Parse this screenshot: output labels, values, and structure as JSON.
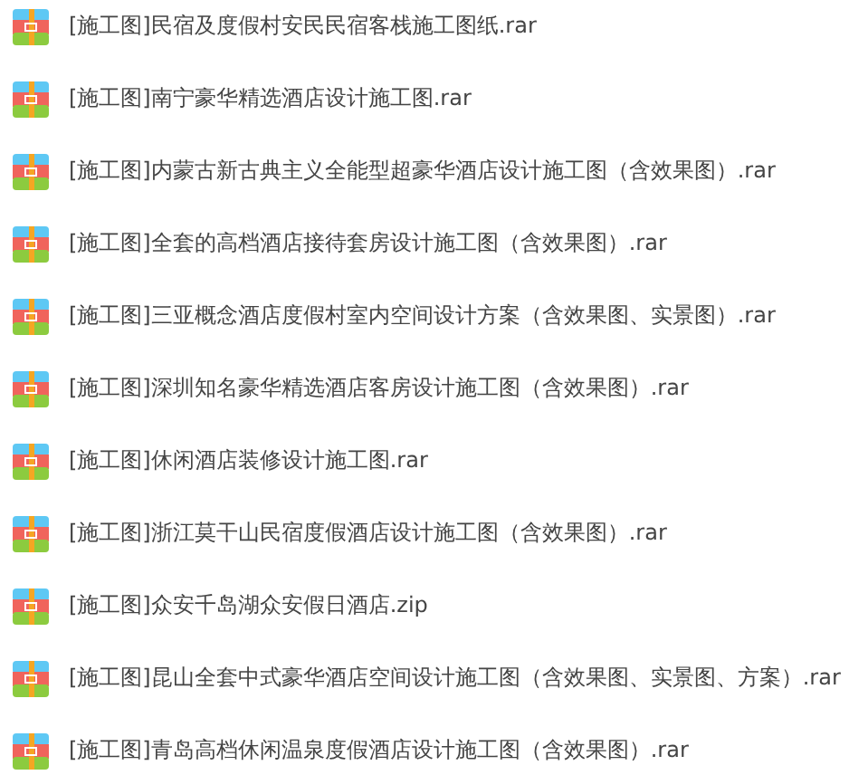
{
  "files": [
    {
      "name": "[施工图]民宿及度假村安民民宿客栈施工图纸.rar"
    },
    {
      "name": "[施工图]南宁豪华精选酒店设计施工图.rar"
    },
    {
      "name": "[施工图]内蒙古新古典主义全能型超豪华酒店设计施工图（含效果图）.rar"
    },
    {
      "name": "[施工图]全套的高档酒店接待套房设计施工图（含效果图）.rar"
    },
    {
      "name": "[施工图]三亚概念酒店度假村室内空间设计方案（含效果图、实景图）.rar"
    },
    {
      "name": "[施工图]深圳知名豪华精选酒店客房设计施工图（含效果图）.rar"
    },
    {
      "name": "[施工图]休闲酒店装修设计施工图.rar"
    },
    {
      "name": "[施工图]浙江莫干山民宿度假酒店设计施工图（含效果图）.rar"
    },
    {
      "name": "[施工图]众安千岛湖众安假日酒店.zip"
    },
    {
      "name": "[施工图]昆山全套中式豪华酒店空间设计施工图（含效果图、实景图、方案）.rar"
    },
    {
      "name": "[施工图]青岛高档休闲温泉度假酒店设计施工图（含效果图）.rar"
    }
  ]
}
